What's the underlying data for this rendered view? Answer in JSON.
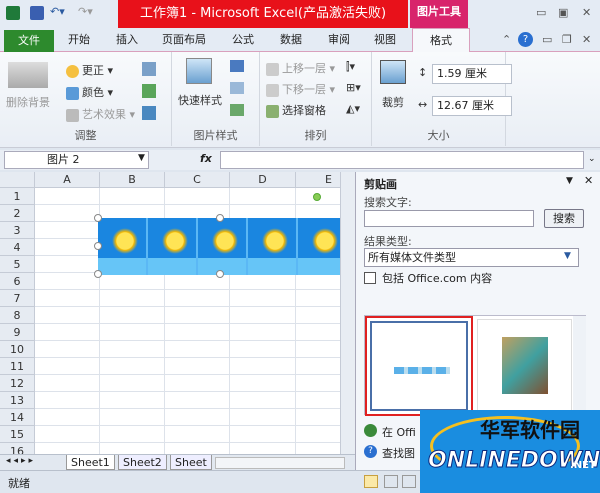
{
  "titlebar": {
    "title": "工作簿1 - Microsoft Excel(产品激活失败)",
    "context_tab": "图片工具",
    "window_controls": [
      "minimize",
      "restore",
      "close"
    ]
  },
  "tabs": [
    "文件",
    "开始",
    "插入",
    "页面布局",
    "公式",
    "数据",
    "审阅",
    "视图",
    "格式"
  ],
  "ribbon": {
    "adjust": {
      "label": "调整",
      "remove_bg": "删除背景",
      "corrections": "更正",
      "color": "颜色",
      "artistic": "艺术效果"
    },
    "styles": {
      "label": "图片样式",
      "quick_styles": "快速样式"
    },
    "arrange": {
      "label": "排列",
      "bring_forward": "上移一层",
      "send_backward": "下移一层",
      "selection_pane": "选择窗格"
    },
    "size": {
      "label": "大小",
      "crop": "裁剪",
      "height": "1.59 厘米",
      "width": "12.67 厘米"
    }
  },
  "formula": {
    "name_box": "图片 2",
    "fx": "fx",
    "value": ""
  },
  "sheet": {
    "columns": [
      "A",
      "B",
      "C",
      "D",
      "E"
    ],
    "rows": [
      "1",
      "2",
      "3",
      "4",
      "5",
      "6",
      "7",
      "8",
      "9",
      "10",
      "11",
      "12",
      "13",
      "14",
      "15",
      "16"
    ],
    "tabs": [
      "Sheet1",
      "Sheet2",
      "Sheet"
    ]
  },
  "status": {
    "text": "就绪"
  },
  "pane": {
    "title": "剪贴画",
    "search_label": "搜索文字:",
    "search_value": "",
    "search_button": "搜索",
    "type_label": "结果类型:",
    "type_value": "所有媒体文件类型",
    "include_office": "包括 Office.com 内容",
    "link1": "在 Offi",
    "link2": "查找图"
  },
  "watermark": {
    "cn": "华军软件园",
    "en": "ONLINEDOWN",
    "net": ".NET"
  }
}
